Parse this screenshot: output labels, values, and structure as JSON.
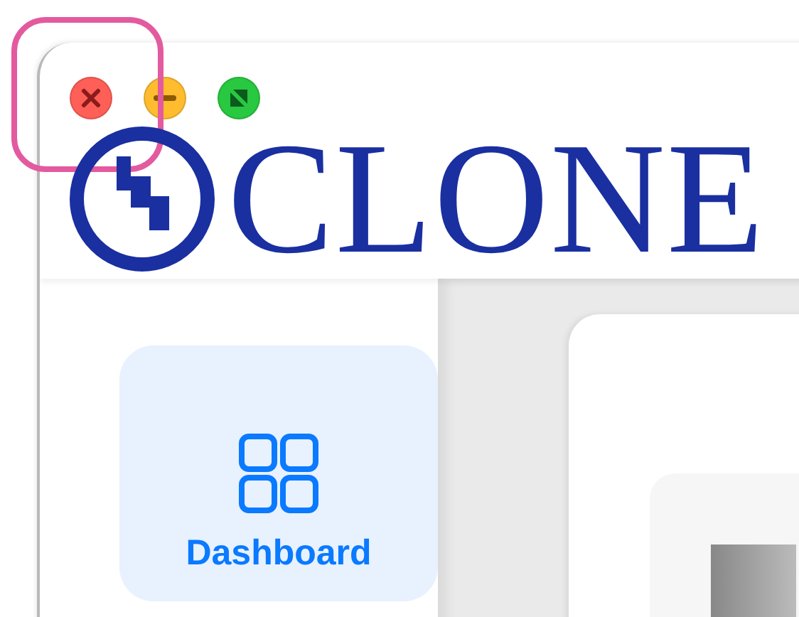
{
  "window": {
    "controls": [
      {
        "kind": "close"
      },
      {
        "kind": "minimize"
      },
      {
        "kind": "zoom"
      }
    ]
  },
  "logo": {
    "text": "CLONE"
  },
  "sidebar": {
    "items": [
      {
        "label": "Dashboard",
        "selected": true
      }
    ]
  }
}
